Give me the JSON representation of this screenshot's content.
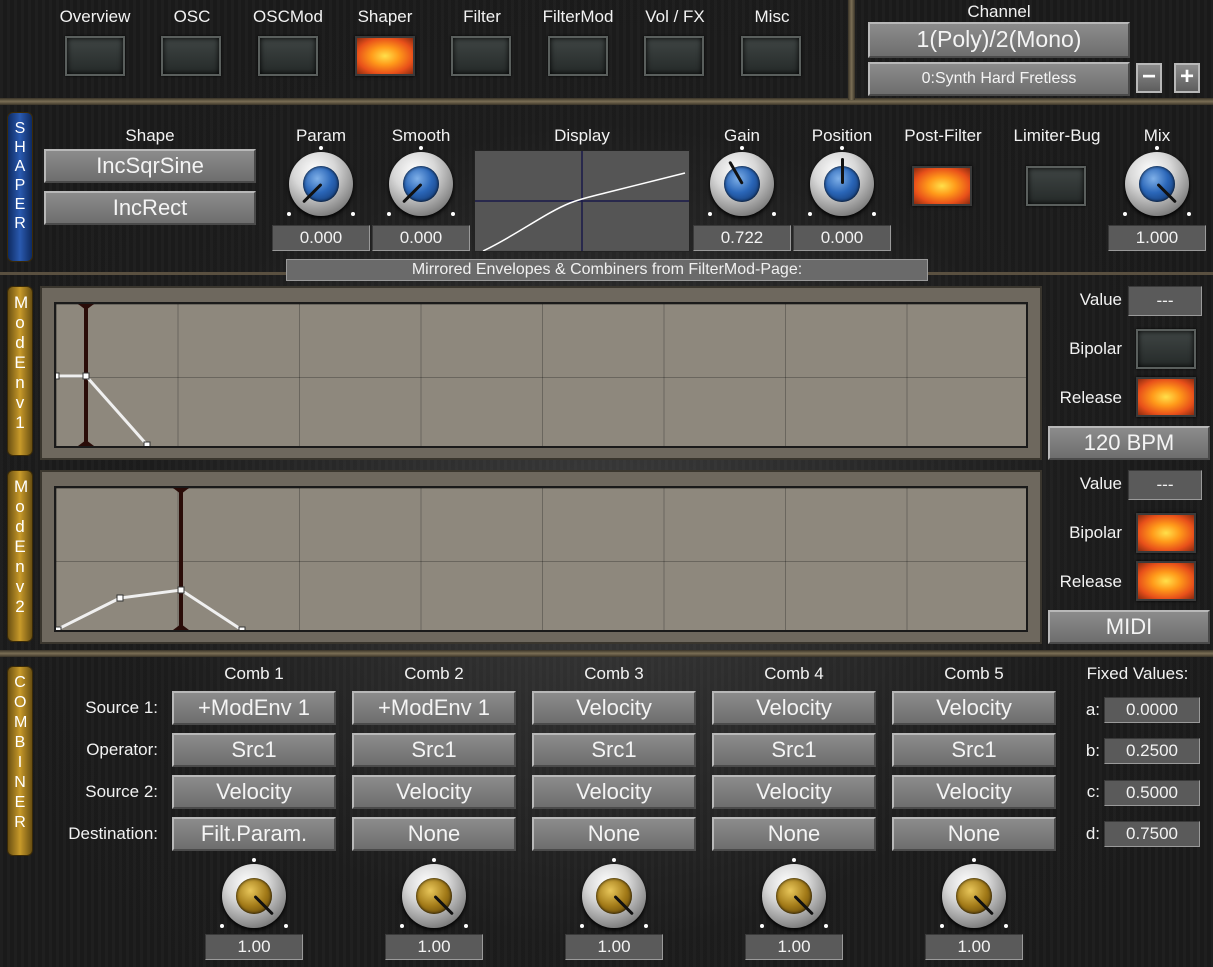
{
  "nav": {
    "tabs": [
      {
        "label": "Overview",
        "active": false
      },
      {
        "label": "OSC",
        "active": false
      },
      {
        "label": "OSCMod",
        "active": false
      },
      {
        "label": "Shaper",
        "active": true
      },
      {
        "label": "Filter",
        "active": false
      },
      {
        "label": "FilterMod",
        "active": false
      },
      {
        "label": "Vol / FX",
        "active": false
      },
      {
        "label": "Misc",
        "active": false
      }
    ]
  },
  "channel": {
    "title": "Channel",
    "mode": "1(Poly)/2(Mono)",
    "preset": "0:Synth Hard Fretless",
    "minus": "−",
    "plus": "+"
  },
  "shaper": {
    "side_tag": "SHAPER",
    "shape_label": "Shape",
    "shape1": "IncSqrSine",
    "shape2": "IncRect",
    "param_label": "Param",
    "param_value": "0.000",
    "smooth_label": "Smooth",
    "smooth_value": "0.000",
    "display_label": "Display",
    "gain_label": "Gain",
    "gain_value": "0.722",
    "position_label": "Position",
    "position_value": "0.000",
    "postfilter_label": "Post-Filter",
    "postfilter_on": true,
    "limiterbug_label": "Limiter-Bug",
    "limiterbug_on": false,
    "mix_label": "Mix",
    "mix_value": "1.000"
  },
  "mirror_banner": "Mirrored Envelopes & Combiners from FilterMod-Page:",
  "env1": {
    "tag": "ModEnv1",
    "value_label": "Value",
    "value": "---",
    "bipolar_label": "Bipolar",
    "bipolar_on": false,
    "release_label": "Release",
    "release_on": true,
    "sync": "120 BPM"
  },
  "env2": {
    "tag": "ModEnv2",
    "value_label": "Value",
    "value": "---",
    "bipolar_label": "Bipolar",
    "bipolar_on": true,
    "release_label": "Release",
    "release_on": true,
    "sync": "MIDI"
  },
  "combiner": {
    "tag": "COMBINER",
    "row_labels": [
      "Source 1:",
      "Operator:",
      "Source 2:",
      "Destination:"
    ],
    "combs": [
      {
        "name": "Comb 1",
        "src1": "+ModEnv 1",
        "op": "Src1",
        "src2": "Velocity",
        "dest": "Filt.Param.",
        "amount": "1.00"
      },
      {
        "name": "Comb 2",
        "src1": "+ModEnv 1",
        "op": "Src1",
        "src2": "Velocity",
        "dest": "None",
        "amount": "1.00"
      },
      {
        "name": "Comb 3",
        "src1": "Velocity",
        "op": "Src1",
        "src2": "Velocity",
        "dest": "None",
        "amount": "1.00"
      },
      {
        "name": "Comb 4",
        "src1": "Velocity",
        "op": "Src1",
        "src2": "Velocity",
        "dest": "None",
        "amount": "1.00"
      },
      {
        "name": "Comb 5",
        "src1": "Velocity",
        "op": "Src1",
        "src2": "Velocity",
        "dest": "None",
        "amount": "1.00"
      }
    ],
    "fixed_title": "Fixed Values:",
    "fixed": [
      {
        "key": "a:",
        "value": "0.0000"
      },
      {
        "key": "b:",
        "value": "0.2500"
      },
      {
        "key": "c:",
        "value": "0.5000"
      },
      {
        "key": "d:",
        "value": "0.7500"
      }
    ]
  }
}
